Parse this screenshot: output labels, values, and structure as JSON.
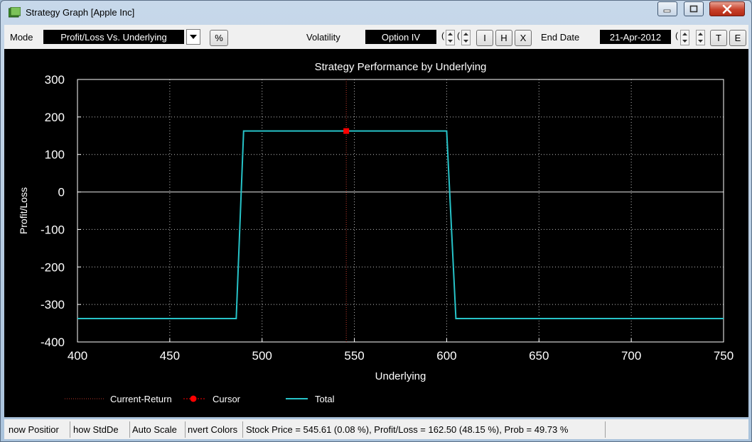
{
  "window": {
    "title": "Strategy Graph [Apple Inc]"
  },
  "toolbar": {
    "mode_label": "Mode",
    "mode_value": "Profit/Loss Vs. Underlying",
    "percent_button": "%",
    "volatility_label": "Volatility",
    "volatility_value": "Option IV",
    "vol_stub_1": "(",
    "vol_stub_2": "(",
    "btn_i": "I",
    "btn_h": "H",
    "btn_x": "X",
    "end_date_label": "End Date",
    "end_date_value": "21-Apr-2012",
    "date_stub": "(",
    "btn_t": "T",
    "btn_e": "E"
  },
  "statusbar": {
    "show_position": "now Positior",
    "show_stddev": "how StdDe",
    "auto_scale": "Auto Scale",
    "invert_colors": "nvert Colors",
    "info": "Stock Price = 545.61 (0.08 %), Profit/Loss = 162.50 (48.15 %), Prob = 49.73 %"
  },
  "colors": {
    "total_line": "#27c3c8",
    "cursor": "#ff0000",
    "current_return": "#c0392b",
    "grid": "#bdbdbd",
    "background": "#000000"
  },
  "chart_data": {
    "type": "line",
    "title": "Strategy Performance by Underlying",
    "xlabel": "Underlying",
    "ylabel": "Profit/Loss",
    "xlim": [
      400,
      750
    ],
    "ylim": [
      -400,
      300
    ],
    "x_ticks": [
      "400",
      "450",
      "500",
      "550",
      "600",
      "650",
      "700",
      "750"
    ],
    "y_ticks": [
      "300",
      "200",
      "100",
      "0",
      "-100",
      "-200",
      "-300",
      "-400"
    ],
    "grid": true,
    "legend_position": "bottom",
    "legend": [
      "Current-Return",
      "Cursor",
      "Total"
    ],
    "series": [
      {
        "name": "Total",
        "x": [
          400,
          486,
          490,
          600,
          605,
          750
        ],
        "y": [
          -337.5,
          -337.5,
          162.5,
          162.5,
          -337.5,
          -337.5
        ]
      }
    ],
    "current_return_x": 545.61,
    "cursor": {
      "x": 545.61,
      "y": 162.5
    }
  }
}
